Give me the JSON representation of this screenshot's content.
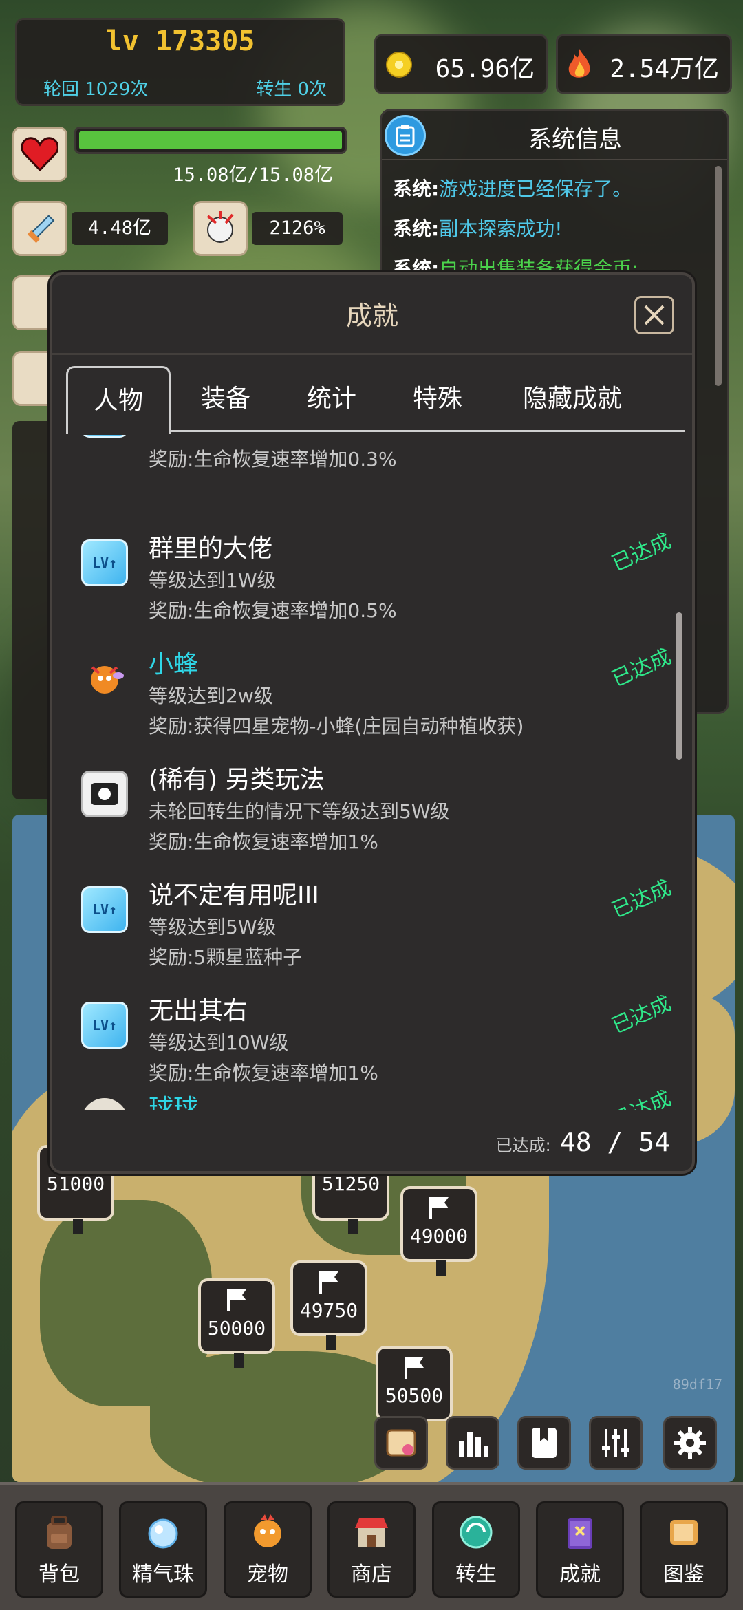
{
  "colors": {
    "gold": "#f2c230",
    "cyan": "#2fd6e6",
    "green_done": "#2fe88a",
    "hp_green": "#58c33e"
  },
  "player": {
    "level": "lv 173305",
    "reincarnation": "轮回 1029次",
    "rebirth": "转生 0次",
    "hp_text": "15.08亿/15.08亿",
    "hp_progress": 1.0,
    "attack": "4.48亿",
    "crit": "2126%"
  },
  "currencies": {
    "gold": "65.96亿",
    "power": "2.54万亿"
  },
  "system_panel": {
    "title": "系统信息",
    "messages": [
      {
        "who": "系统:",
        "text": "游戏进度已经保存了。"
      },
      {
        "who": "系统:",
        "text": "副本探索成功!"
      },
      {
        "who": "系统:",
        "text": "自动出售装备获得金币:"
      }
    ]
  },
  "modal": {
    "title": "成就",
    "tabs": [
      "人物",
      "装备",
      "统计",
      "特殊",
      "隐藏成就"
    ],
    "active_tab": "人物",
    "done_label": "已达成",
    "items": [
      {
        "name": "",
        "cond": "",
        "reward": "奖励:生命恢复速率增加0.3%",
        "done": false
      },
      {
        "name": "群里的大佬",
        "cond": "等级达到1W级",
        "reward": "奖励:生命恢复速率增加0.5%",
        "done": true
      },
      {
        "name": "小蜂",
        "cond": "等级达到2w级",
        "reward": "奖励:获得四星宠物-小蜂(庄园自动种植收获)",
        "done": true
      },
      {
        "name": "(稀有) 另类玩法",
        "cond": "未轮回转生的情况下等级达到5W级",
        "reward": "奖励:生命恢复速率增加1%",
        "done": false
      },
      {
        "name": "说不定有用呢III",
        "cond": "等级达到5W级",
        "reward": "奖励:5颗星蓝种子",
        "done": true
      },
      {
        "name": "无出其右",
        "cond": "等级达到10W级",
        "reward": "奖励:生命恢复速率增加1%",
        "done": true
      },
      {
        "name": "球球",
        "cond": "",
        "reward": "",
        "done": true
      }
    ],
    "footer_label": "已达成:",
    "footer_count": "48 / 54"
  },
  "map": {
    "markers": [
      "51000",
      "51250",
      "49000",
      "50000",
      "49750",
      "50500"
    ],
    "code": "89df17"
  },
  "bottom_nav": [
    "背包",
    "精气珠",
    "宠物",
    "商店",
    "转生",
    "成就",
    "图鉴"
  ]
}
